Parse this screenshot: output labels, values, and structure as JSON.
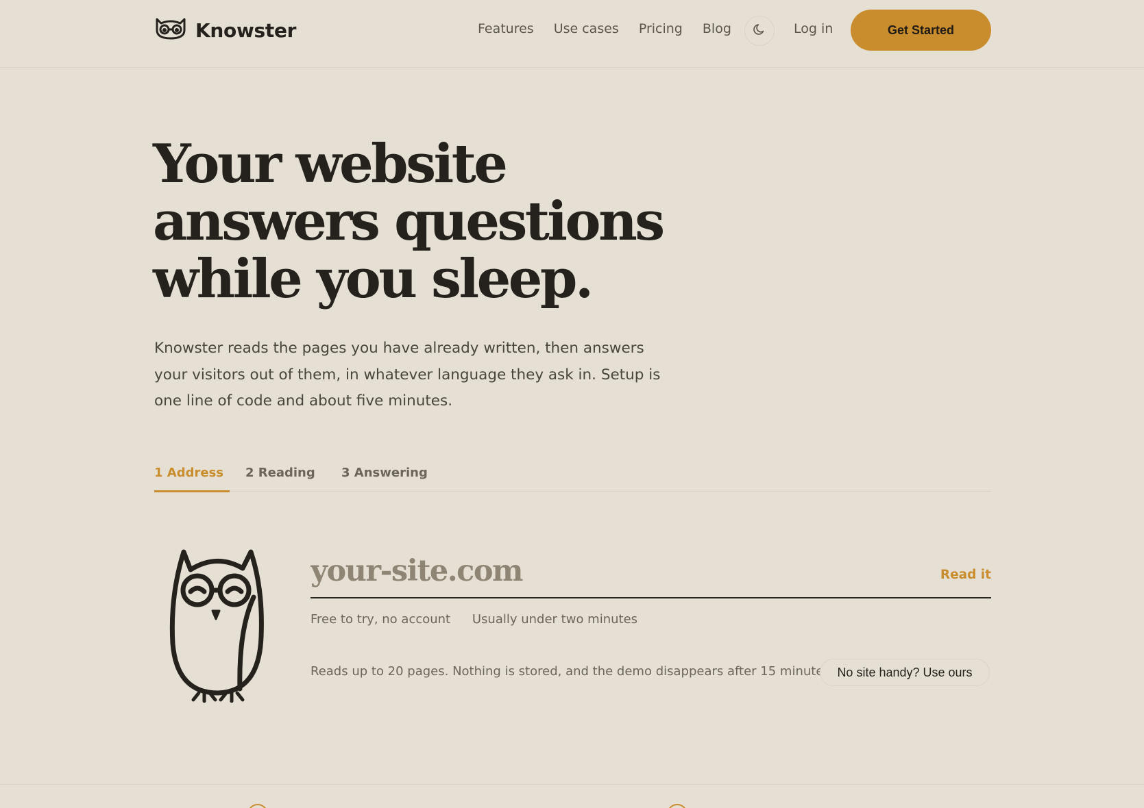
{
  "brand": {
    "name": "Knowster",
    "logo_icon": "owl-logo-icon"
  },
  "nav": {
    "items": [
      "Features",
      "Use cases",
      "Pricing",
      "Blog"
    ],
    "theme_toggle_icon": "moon-icon",
    "login_label": "Log in",
    "cta_label": "Get Started"
  },
  "hero": {
    "headline_lines": [
      "Your website",
      "answers questions",
      "while you sleep."
    ],
    "subtext": "Knowster reads the pages you have already written, then answers your visitors out of them, in whatever language they ask in. Setup is one line of code and about five minutes."
  },
  "steps": {
    "items": [
      "1 Address",
      "2 Reading",
      "3 Answering"
    ],
    "active_index": 0
  },
  "demo": {
    "mascot_icon": "owl-mascot-icon",
    "url_placeholder": "your-site.com",
    "url_value": "",
    "submit_label": "Read it",
    "meta": [
      "Free to try, no account",
      "Usually under two minutes"
    ],
    "note": "Reads up to 20 pages. Nothing is stored, and the demo disappears after 15 minutes.",
    "sample_button_label": "No site handy? Use ours"
  },
  "colors": {
    "background": "#e6e0d4",
    "accent": "#c98d2e",
    "text": "#25221d",
    "muted": "#6b655a"
  }
}
